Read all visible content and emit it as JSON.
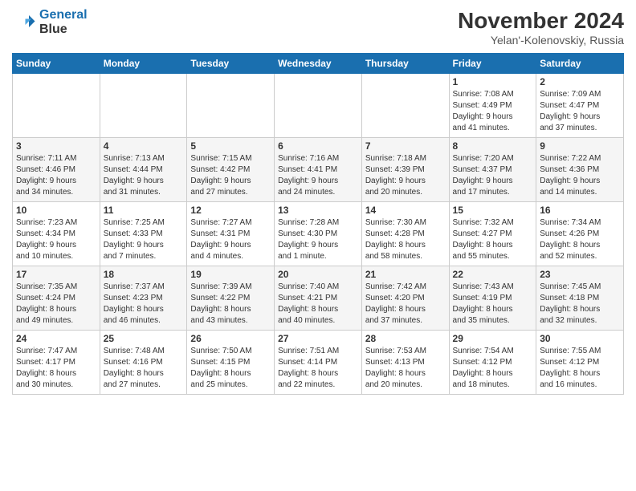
{
  "logo": {
    "line1": "General",
    "line2": "Blue"
  },
  "title": "November 2024",
  "subtitle": "Yelan'-Kolenovskiy, Russia",
  "headers": [
    "Sunday",
    "Monday",
    "Tuesday",
    "Wednesday",
    "Thursday",
    "Friday",
    "Saturday"
  ],
  "weeks": [
    [
      {
        "day": "",
        "info": ""
      },
      {
        "day": "",
        "info": ""
      },
      {
        "day": "",
        "info": ""
      },
      {
        "day": "",
        "info": ""
      },
      {
        "day": "",
        "info": ""
      },
      {
        "day": "1",
        "info": "Sunrise: 7:08 AM\nSunset: 4:49 PM\nDaylight: 9 hours\nand 41 minutes."
      },
      {
        "day": "2",
        "info": "Sunrise: 7:09 AM\nSunset: 4:47 PM\nDaylight: 9 hours\nand 37 minutes."
      }
    ],
    [
      {
        "day": "3",
        "info": "Sunrise: 7:11 AM\nSunset: 4:46 PM\nDaylight: 9 hours\nand 34 minutes."
      },
      {
        "day": "4",
        "info": "Sunrise: 7:13 AM\nSunset: 4:44 PM\nDaylight: 9 hours\nand 31 minutes."
      },
      {
        "day": "5",
        "info": "Sunrise: 7:15 AM\nSunset: 4:42 PM\nDaylight: 9 hours\nand 27 minutes."
      },
      {
        "day": "6",
        "info": "Sunrise: 7:16 AM\nSunset: 4:41 PM\nDaylight: 9 hours\nand 24 minutes."
      },
      {
        "day": "7",
        "info": "Sunrise: 7:18 AM\nSunset: 4:39 PM\nDaylight: 9 hours\nand 20 minutes."
      },
      {
        "day": "8",
        "info": "Sunrise: 7:20 AM\nSunset: 4:37 PM\nDaylight: 9 hours\nand 17 minutes."
      },
      {
        "day": "9",
        "info": "Sunrise: 7:22 AM\nSunset: 4:36 PM\nDaylight: 9 hours\nand 14 minutes."
      }
    ],
    [
      {
        "day": "10",
        "info": "Sunrise: 7:23 AM\nSunset: 4:34 PM\nDaylight: 9 hours\nand 10 minutes."
      },
      {
        "day": "11",
        "info": "Sunrise: 7:25 AM\nSunset: 4:33 PM\nDaylight: 9 hours\nand 7 minutes."
      },
      {
        "day": "12",
        "info": "Sunrise: 7:27 AM\nSunset: 4:31 PM\nDaylight: 9 hours\nand 4 minutes."
      },
      {
        "day": "13",
        "info": "Sunrise: 7:28 AM\nSunset: 4:30 PM\nDaylight: 9 hours\nand 1 minute."
      },
      {
        "day": "14",
        "info": "Sunrise: 7:30 AM\nSunset: 4:28 PM\nDaylight: 8 hours\nand 58 minutes."
      },
      {
        "day": "15",
        "info": "Sunrise: 7:32 AM\nSunset: 4:27 PM\nDaylight: 8 hours\nand 55 minutes."
      },
      {
        "day": "16",
        "info": "Sunrise: 7:34 AM\nSunset: 4:26 PM\nDaylight: 8 hours\nand 52 minutes."
      }
    ],
    [
      {
        "day": "17",
        "info": "Sunrise: 7:35 AM\nSunset: 4:24 PM\nDaylight: 8 hours\nand 49 minutes."
      },
      {
        "day": "18",
        "info": "Sunrise: 7:37 AM\nSunset: 4:23 PM\nDaylight: 8 hours\nand 46 minutes."
      },
      {
        "day": "19",
        "info": "Sunrise: 7:39 AM\nSunset: 4:22 PM\nDaylight: 8 hours\nand 43 minutes."
      },
      {
        "day": "20",
        "info": "Sunrise: 7:40 AM\nSunset: 4:21 PM\nDaylight: 8 hours\nand 40 minutes."
      },
      {
        "day": "21",
        "info": "Sunrise: 7:42 AM\nSunset: 4:20 PM\nDaylight: 8 hours\nand 37 minutes."
      },
      {
        "day": "22",
        "info": "Sunrise: 7:43 AM\nSunset: 4:19 PM\nDaylight: 8 hours\nand 35 minutes."
      },
      {
        "day": "23",
        "info": "Sunrise: 7:45 AM\nSunset: 4:18 PM\nDaylight: 8 hours\nand 32 minutes."
      }
    ],
    [
      {
        "day": "24",
        "info": "Sunrise: 7:47 AM\nSunset: 4:17 PM\nDaylight: 8 hours\nand 30 minutes."
      },
      {
        "day": "25",
        "info": "Sunrise: 7:48 AM\nSunset: 4:16 PM\nDaylight: 8 hours\nand 27 minutes."
      },
      {
        "day": "26",
        "info": "Sunrise: 7:50 AM\nSunset: 4:15 PM\nDaylight: 8 hours\nand 25 minutes."
      },
      {
        "day": "27",
        "info": "Sunrise: 7:51 AM\nSunset: 4:14 PM\nDaylight: 8 hours\nand 22 minutes."
      },
      {
        "day": "28",
        "info": "Sunrise: 7:53 AM\nSunset: 4:13 PM\nDaylight: 8 hours\nand 20 minutes."
      },
      {
        "day": "29",
        "info": "Sunrise: 7:54 AM\nSunset: 4:12 PM\nDaylight: 8 hours\nand 18 minutes."
      },
      {
        "day": "30",
        "info": "Sunrise: 7:55 AM\nSunset: 4:12 PM\nDaylight: 8 hours\nand 16 minutes."
      }
    ]
  ]
}
